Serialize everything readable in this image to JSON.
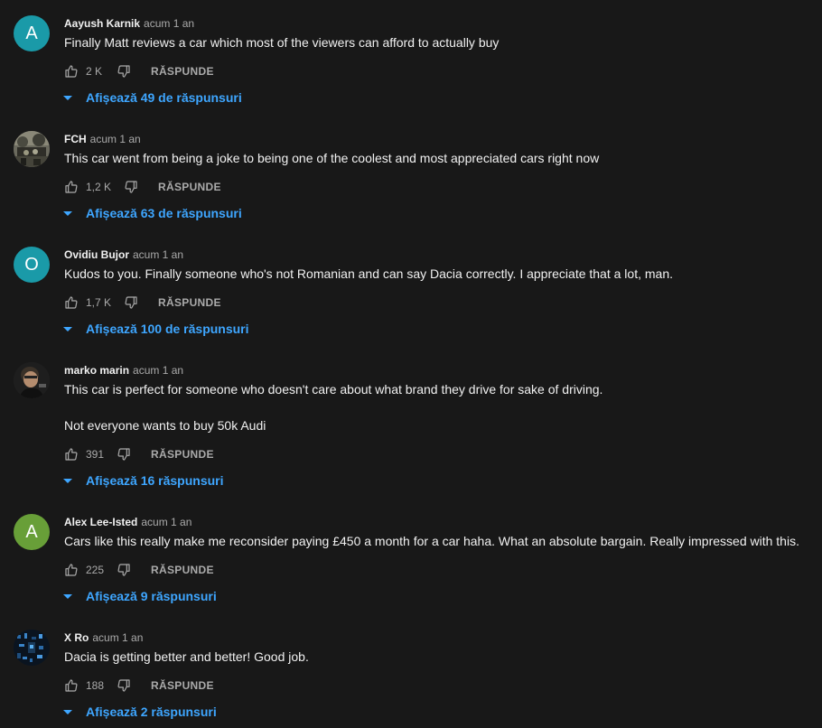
{
  "comments": [
    {
      "author": "Aayush Karnik",
      "time": "acum 1 an",
      "avatar_letter": "A",
      "avatar_color": "#1a9aa8",
      "text": "Finally Matt reviews a car which most of the viewers can afford to actually buy",
      "likes": "2 K",
      "reply_label": "RĂSPUNDE",
      "replies_label": "Afișează 49 de răspunsuri"
    },
    {
      "author": "FCH",
      "time": "acum 1 an",
      "avatar_letter": "",
      "avatar_color": "#5a5a52",
      "text": "This car went from being a joke to being one of the coolest and most appreciated cars right now",
      "likes": "1,2 K",
      "reply_label": "RĂSPUNDE",
      "replies_label": "Afișează 63 de răspunsuri"
    },
    {
      "author": "Ovidiu Bujor",
      "time": "acum 1 an",
      "avatar_letter": "O",
      "avatar_color": "#1a9aa8",
      "text": "Kudos to you. Finally someone who's not Romanian and can say Dacia correctly. I appreciate that a lot, man.",
      "likes": "1,7 K",
      "reply_label": "RĂSPUNDE",
      "replies_label": "Afișează 100 de răspunsuri"
    },
    {
      "author": "marko marin",
      "time": "acum 1 an",
      "avatar_letter": "",
      "avatar_color": "#2a2a2a",
      "text": "This car is perfect for someone who doesn't care about what brand they drive for sake of driving.\n\nNot everyone wants to buy 50k Audi",
      "likes": "391",
      "reply_label": "RĂSPUNDE",
      "replies_label": "Afișează 16 răspunsuri"
    },
    {
      "author": "Alex Lee-Isted",
      "time": "acum 1 an",
      "avatar_letter": "A",
      "avatar_color": "#689f38",
      "text": "Cars like this really make me reconsider paying £450 a month for a car haha. What an absolute bargain. Really impressed with this.",
      "likes": "225",
      "reply_label": "RĂSPUNDE",
      "replies_label": "Afișează 9 răspunsuri"
    },
    {
      "author": "X Ro",
      "time": "acum 1 an",
      "avatar_letter": "",
      "avatar_color": "#0c1a2a",
      "text": "Dacia is getting better and better! Good job.",
      "likes": "188",
      "reply_label": "RĂSPUNDE",
      "replies_label": "Afișează 2 răspunsuri"
    }
  ]
}
